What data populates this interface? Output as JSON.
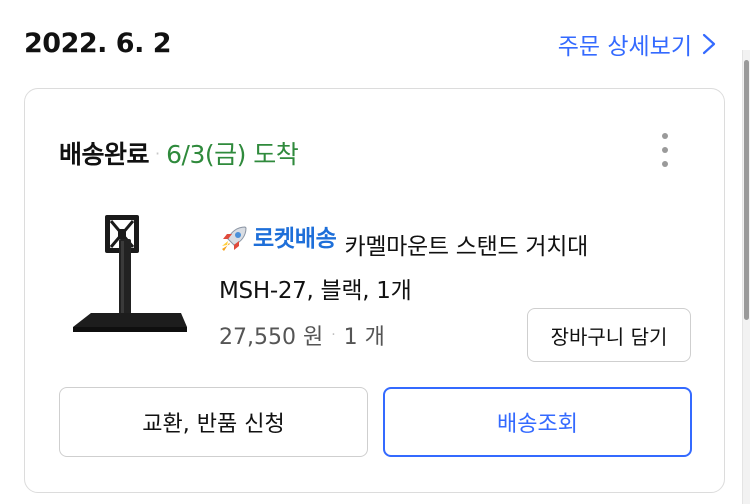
{
  "order": {
    "date": "2022. 6. 2",
    "detail_link": "주문 상세보기"
  },
  "shipment": {
    "status": "배송완료",
    "separator": "·",
    "arrival": "6/3(금) 도착"
  },
  "product": {
    "badge": "로켓배송",
    "name_line1": "카멜마운트 스탠드 거치대",
    "name_line2": "MSH-27, 블랙, 1개",
    "price": "27,550 원",
    "quantity": "1 개",
    "cart_button": "장바구니 담기"
  },
  "actions": {
    "exchange_return": "교환, 반품 신청",
    "track_delivery": "배송조회"
  },
  "colors": {
    "accent": "#346aff",
    "arrival_green": "#2f8a3c",
    "rocket_blue": "#1e6fd9"
  },
  "icons": {
    "detail_chevron": "chevron-right-icon",
    "menu": "more-vertical-icon",
    "rocket": "rocket-icon"
  }
}
